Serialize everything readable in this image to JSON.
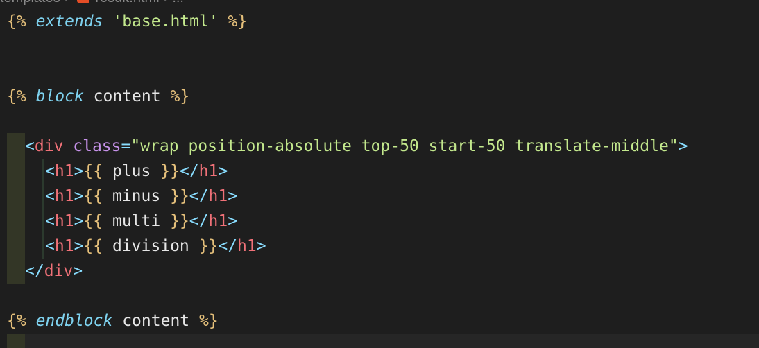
{
  "breadcrumb": {
    "folder": "templates",
    "file": "result.html",
    "symbol": "..."
  },
  "code": {
    "line1": {
      "open": "{%",
      "keyword": "extends",
      "string": "'base.html'",
      "close": "%}"
    },
    "line2": {
      "open": "{%",
      "keyword": "block",
      "name": "content",
      "close": "%}"
    },
    "div_open": {
      "lt": "<",
      "tag": "div",
      "attr": "class",
      "eq": "=",
      "value": "\"wrap position-absolute top-50 start-50 translate-middle\"",
      "gt": ">"
    },
    "h1_lines": [
      {
        "var": "plus"
      },
      {
        "var": "minus"
      },
      {
        "var": "multi"
      },
      {
        "var": "division"
      }
    ],
    "h1_tag": "h1",
    "var_open": "{{",
    "var_close": "}}",
    "div_close": {
      "lt": "</",
      "tag": "div",
      "gt": ">"
    },
    "endblock": {
      "open": "{%",
      "keyword": "endblock",
      "name": "content",
      "close": "%}"
    }
  }
}
